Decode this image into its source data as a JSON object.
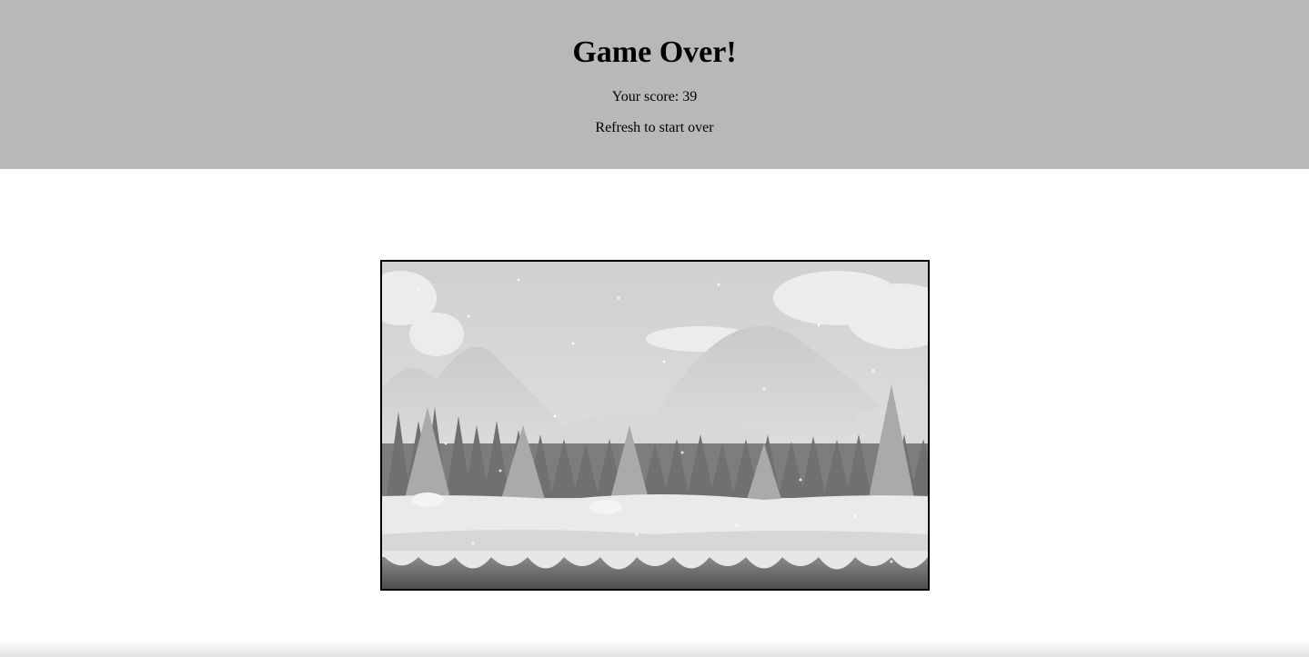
{
  "game_over": {
    "title": "Game Over!",
    "score_text": "Your score: 39",
    "restart_hint": "Refresh to start over"
  },
  "game_canvas": {
    "scene": "snowy-forest-background",
    "palette": {
      "sky": "#d6d7d8",
      "mountain": "#cfd0d1",
      "trees": "#6f7071",
      "snow": "#eceded",
      "rock": "#5a5b5c"
    }
  }
}
